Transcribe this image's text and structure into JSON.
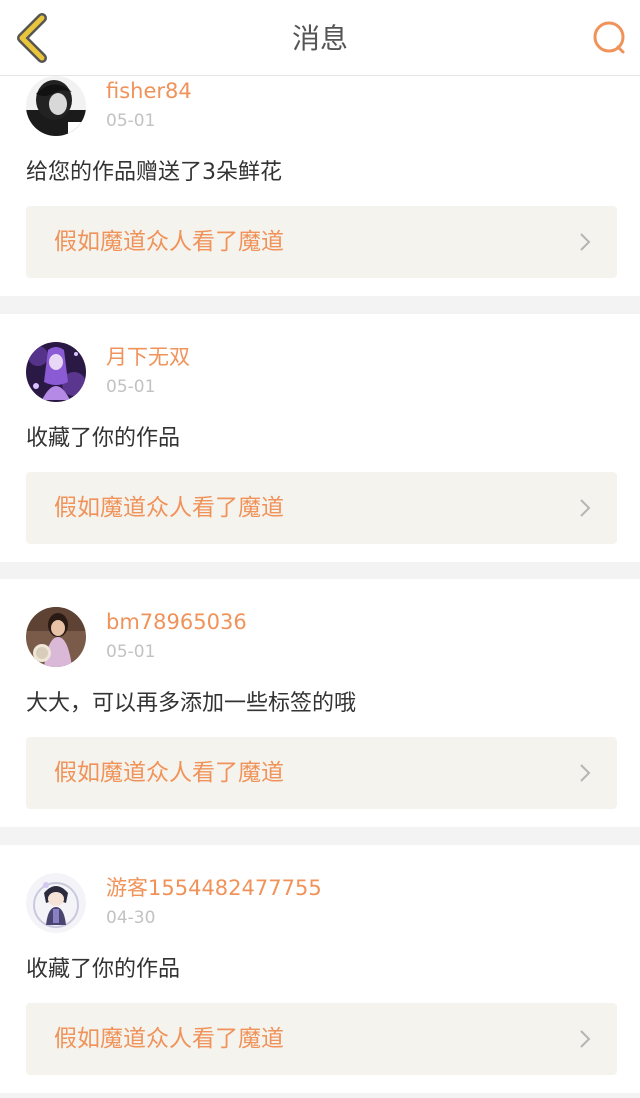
{
  "header": {
    "title": "消息",
    "back_icon": "chevron-left-icon",
    "search_icon": "search-icon",
    "accent_color": "#e8c53a",
    "search_color": "#f0935a"
  },
  "messages": [
    {
      "username": "fisher84",
      "date": "05-01",
      "text": "给您的作品赠送了3朵鲜花",
      "work_title": "假如魔道众人看了魔道",
      "avatar": "dark-portrait-avatar"
    },
    {
      "username": "月下无双",
      "date": "05-01",
      "text": "收藏了你的作品",
      "work_title": "假如魔道众人看了魔道",
      "avatar": "purple-anime-avatar"
    },
    {
      "username": "bm78965036",
      "date": "05-01",
      "text": "大大，可以再多添加一些标签的哦",
      "work_title": "假如魔道众人看了魔道",
      "avatar": "woman-qipao-avatar"
    },
    {
      "username": "游客1554482477755",
      "date": "04-30",
      "text": "收藏了你的作品",
      "work_title": "假如魔道众人看了魔道",
      "avatar": "chibi-anime-avatar"
    }
  ],
  "colors": {
    "username": "#f0935a",
    "work_title": "#f0935a",
    "work_bg": "#f5f3ed",
    "date": "#c2c2c2",
    "text": "#333333",
    "page_bg": "#f3f3f3"
  }
}
